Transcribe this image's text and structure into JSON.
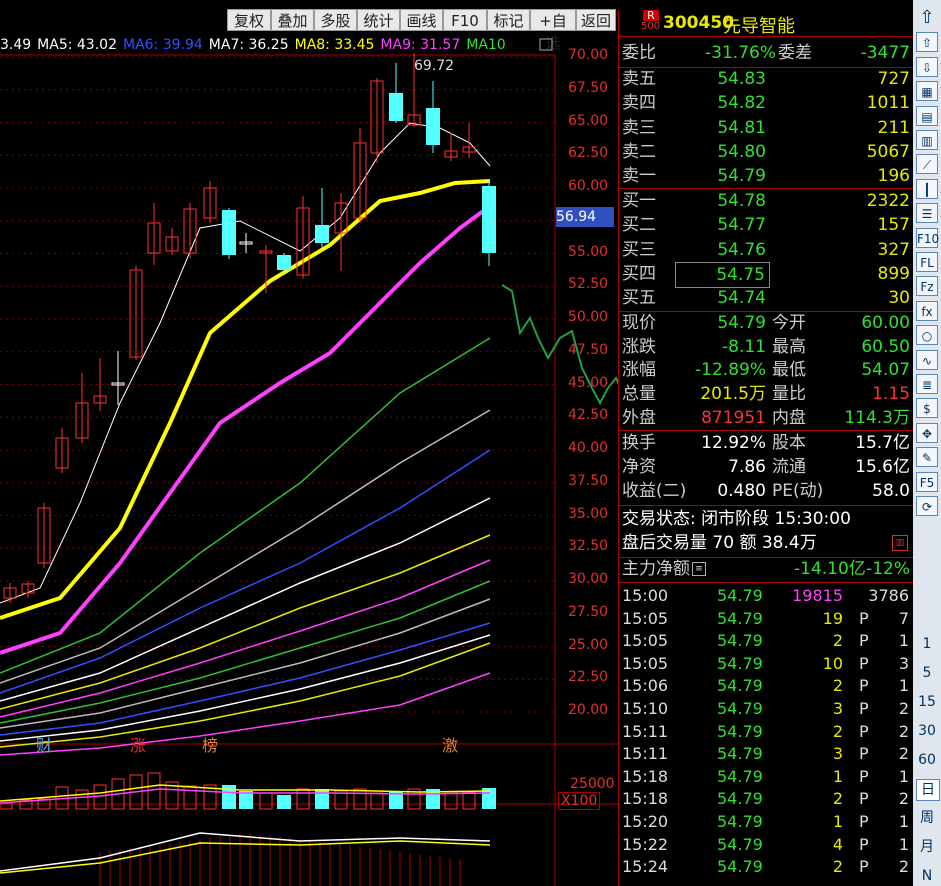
{
  "toolbar": {
    "buttons": [
      "复权",
      "叠加",
      "多股",
      "统计",
      "画线",
      "F10",
      "标记",
      "+自选",
      "返回"
    ]
  },
  "ma_legend": [
    {
      "label": "3.49",
      "color": "#ffffff"
    },
    {
      "label": "MA5: 43.02",
      "color": "#ffffff"
    },
    {
      "label": "MA6: 39.94",
      "color": "#3050ff"
    },
    {
      "label": "MA7: 36.25",
      "color": "#ffffff"
    },
    {
      "label": "MA8: 33.45",
      "color": "#ffff00"
    },
    {
      "label": "MA9: 31.57",
      "color": "#ff40ff"
    },
    {
      "label": "MA10",
      "color": "#30e030"
    }
  ],
  "chart": {
    "high_label": "69.72",
    "current_price_tag": "56.94",
    "y_axis": [
      "70.00",
      "67.50",
      "65.00",
      "62.50",
      "60.00",
      "57.50",
      "55.00",
      "52.50",
      "50.00",
      "47.50",
      "45.00",
      "42.50",
      "40.00",
      "37.50",
      "35.00",
      "32.50",
      "30.00",
      "27.50",
      "25.00",
      "22.50",
      "20.00"
    ],
    "markers": [
      "财",
      "涨",
      "榜",
      "激"
    ],
    "volume_axis": "25000",
    "volume_unit": "X100"
  },
  "stock": {
    "code": "300450",
    "name": "先导智能",
    "badge_top": "R",
    "badge_bottom": "500"
  },
  "order_stats": {
    "wb_label": "委比",
    "wb_value": "-31.76%",
    "wc_label": "委差",
    "wc_value": "-3477"
  },
  "asks": [
    {
      "label": "卖五",
      "price": "54.83",
      "vol": "727"
    },
    {
      "label": "卖四",
      "price": "54.82",
      "vol": "1011"
    },
    {
      "label": "卖三",
      "price": "54.81",
      "vol": "211"
    },
    {
      "label": "卖二",
      "price": "54.80",
      "vol": "5067"
    },
    {
      "label": "卖一",
      "price": "54.79",
      "vol": "196"
    }
  ],
  "bids": [
    {
      "label": "买一",
      "price": "54.78",
      "vol": "2322"
    },
    {
      "label": "买二",
      "price": "54.77",
      "vol": "157"
    },
    {
      "label": "买三",
      "price": "54.76",
      "vol": "327"
    },
    {
      "label": "买四",
      "price": "54.75",
      "vol": "899"
    },
    {
      "label": "买五",
      "price": "54.74",
      "vol": "30"
    }
  ],
  "quote": [
    {
      "l1": "现价",
      "v1": "54.79",
      "c1": "green",
      "l2": "今开",
      "v2": "60.00",
      "c2": "green"
    },
    {
      "l1": "涨跌",
      "v1": "-8.11",
      "c1": "green",
      "l2": "最高",
      "v2": "60.50",
      "c2": "green"
    },
    {
      "l1": "涨幅",
      "v1": "-12.89%",
      "c1": "green",
      "l2": "最低",
      "v2": "54.07",
      "c2": "green"
    },
    {
      "l1": "总量",
      "v1": "201.5万",
      "c1": "yellow",
      "l2": "量比",
      "v2": "1.15",
      "c2": "red"
    },
    {
      "l1": "外盘",
      "v1": "871951",
      "c1": "red",
      "l2": "内盘",
      "v2": "114.3万",
      "c2": "green"
    }
  ],
  "fundamentals": [
    {
      "l1": "换手",
      "v1": "12.92%",
      "l2": "股本",
      "v2": "15.7亿"
    },
    {
      "l1": "净资",
      "v1": "7.86",
      "l2": "流通",
      "v2": "15.6亿"
    },
    {
      "l1": "收益(二)",
      "v1": "0.480",
      "l2": "PE(动)",
      "v2": "58.0"
    }
  ],
  "trade_status": "交易状态: 闭市阶段 15:30:00",
  "after_hours": "盘后交易量 70 额 38.4万",
  "main_flow": {
    "label": "主力净额",
    "value": "-14.10亿",
    "pct": "-12%"
  },
  "ticks": [
    {
      "t": "15:00",
      "p": "54.79",
      "q": "19815",
      "qc": "#ff40ff",
      "bs": "",
      "n": "3786"
    },
    {
      "t": "15:05",
      "p": "54.79",
      "q": "19",
      "qc": "#e8e800",
      "bs": "P",
      "n": "7"
    },
    {
      "t": "15:05",
      "p": "54.79",
      "q": "2",
      "qc": "#e8e800",
      "bs": "P",
      "n": "1"
    },
    {
      "t": "15:05",
      "p": "54.79",
      "q": "10",
      "qc": "#e8e800",
      "bs": "P",
      "n": "3"
    },
    {
      "t": "15:06",
      "p": "54.79",
      "q": "2",
      "qc": "#e8e800",
      "bs": "P",
      "n": "1"
    },
    {
      "t": "15:10",
      "p": "54.79",
      "q": "3",
      "qc": "#e8e800",
      "bs": "P",
      "n": "2"
    },
    {
      "t": "15:11",
      "p": "54.79",
      "q": "2",
      "qc": "#e8e800",
      "bs": "P",
      "n": "2"
    },
    {
      "t": "15:11",
      "p": "54.79",
      "q": "3",
      "qc": "#e8e800",
      "bs": "P",
      "n": "2"
    },
    {
      "t": "15:18",
      "p": "54.79",
      "q": "1",
      "qc": "#e8e800",
      "bs": "P",
      "n": "1"
    },
    {
      "t": "15:18",
      "p": "54.79",
      "q": "2",
      "qc": "#e8e800",
      "bs": "P",
      "n": "2"
    },
    {
      "t": "15:20",
      "p": "54.79",
      "q": "1",
      "qc": "#e8e800",
      "bs": "P",
      "n": "1"
    },
    {
      "t": "15:22",
      "p": "54.79",
      "q": "4",
      "qc": "#e8e800",
      "bs": "P",
      "n": "1"
    },
    {
      "t": "15:24",
      "p": "54.79",
      "q": "2",
      "qc": "#e8e800",
      "bs": "P",
      "n": "2"
    }
  ],
  "sidebar_periods": [
    "1",
    "5",
    "15",
    "30",
    "60",
    "日",
    "周",
    "月",
    "N"
  ]
}
